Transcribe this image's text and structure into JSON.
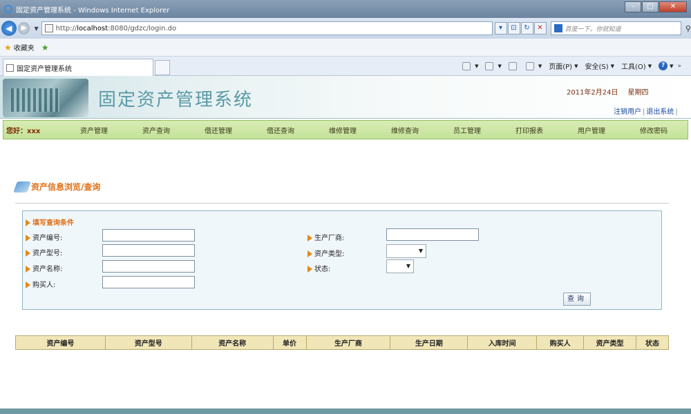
{
  "window": {
    "title": "固定资产管理系统 - Windows Internet Explorer",
    "minimize_label": "–",
    "maximize_label": "□",
    "close_label": "✕"
  },
  "browser": {
    "url_prefix": "http://",
    "url_host": "localhost",
    "url_rest": ":8080/gdzc/login.do",
    "search_placeholder": "百度一下，你就知道",
    "favorites_label": "收藏夹",
    "tab_title": "固定资产管理系统",
    "commands": [
      "页面(P)",
      "安全(S)",
      "工具(O)"
    ]
  },
  "header": {
    "system_title": "固定资产管理系统",
    "date": "2011年2月24日",
    "weekday": "星期四",
    "logout_user": "注销用户",
    "exit_system": "退出系统",
    "separator": "|"
  },
  "menu": {
    "greeting": "您好：",
    "username": "xxx",
    "items": [
      "资产管理",
      "资产查询",
      "借还管理",
      "借还查询",
      "维修管理",
      "维修查询",
      "员工管理",
      "打印报表",
      "用户管理",
      "修改密码"
    ]
  },
  "section": {
    "title": "资产信息浏览/查询"
  },
  "query": {
    "heading": "填写查询条件",
    "fields": {
      "asset_no": {
        "label": "资产编号:",
        "value": ""
      },
      "asset_model": {
        "label": "资产型号:",
        "value": ""
      },
      "asset_name": {
        "label": "资产名称:",
        "value": ""
      },
      "buyer": {
        "label": "购买人:",
        "value": ""
      },
      "manufacturer": {
        "label": "生产厂商:",
        "value": ""
      },
      "asset_type": {
        "label": "资产类型:",
        "value": ""
      },
      "status": {
        "label": "状态:",
        "value": ""
      }
    },
    "button": "查询"
  },
  "table": {
    "columns": [
      "资产编号",
      "资产型号",
      "资产名称",
      "单价",
      "生产厂商",
      "生产日期",
      "入库时间",
      "购买人",
      "资产类型",
      "状态"
    ]
  },
  "colors": {
    "menu_bg": "#c4e29a",
    "accent_orange": "#e07018",
    "title_teal": "#5a9aa6",
    "table_header": "#f1e6b8",
    "panel_bg": "#f0f7fb"
  }
}
